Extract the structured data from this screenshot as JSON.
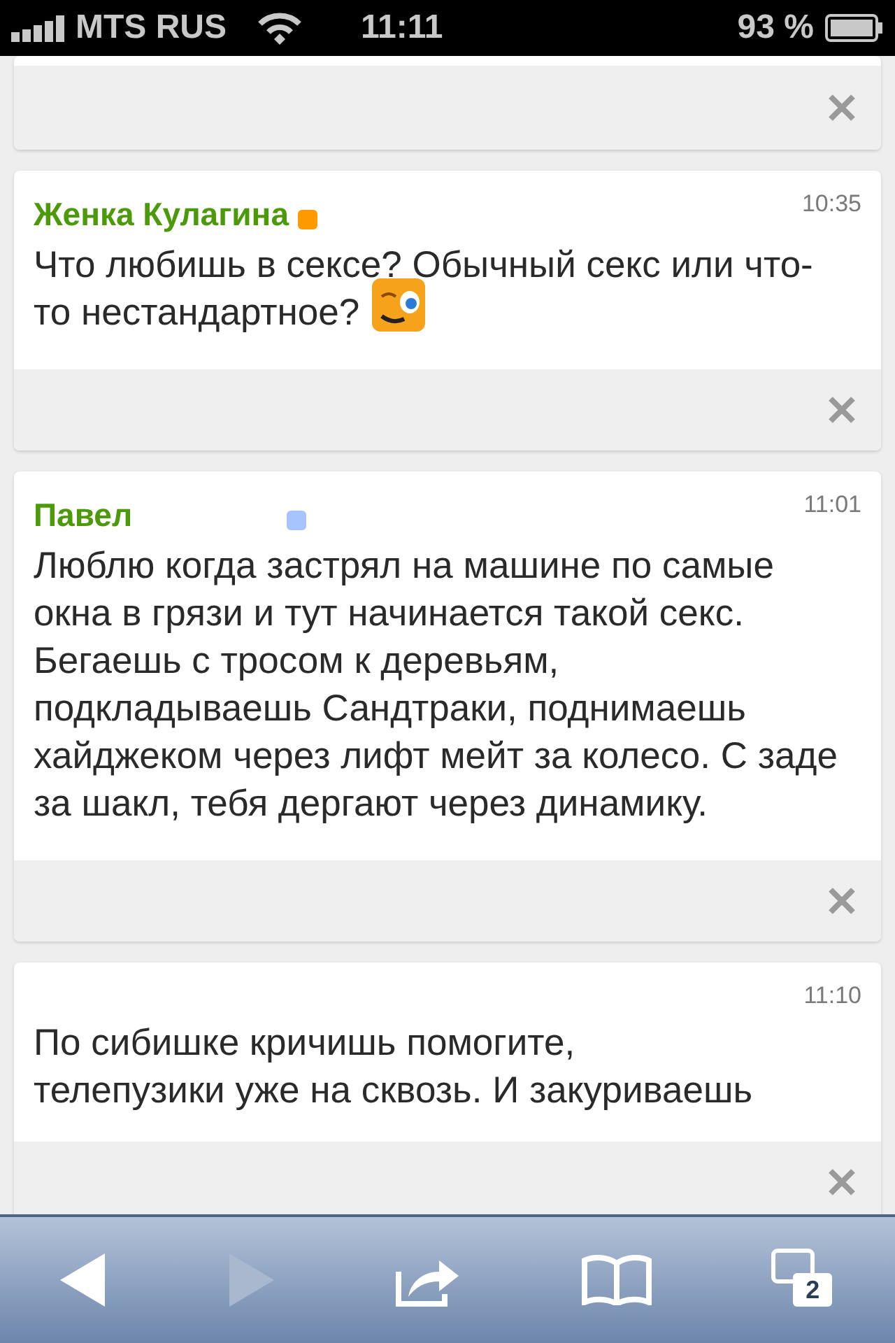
{
  "status_bar": {
    "carrier": "MTS RUS",
    "time": "11:11",
    "battery": "93 %"
  },
  "messages": [
    {
      "kind": "cut"
    },
    {
      "kind": "full",
      "author": "Женка Кулагина",
      "color": "#ff9900",
      "time": "10:35",
      "text": "Что любишь в сексе? Обычный секс или что-то нестандартное?",
      "emoji": true
    },
    {
      "kind": "full",
      "author": "Павел",
      "color": "#a8c4ff",
      "time": "11:01",
      "text": "Люблю когда застрял на машине по самые окна в грязи и тут начинается такой секс. Бегаешь с тросом к деревьям, подкладываешь Сандтраки, поднимаешь хайджеком через лифт мейт за колесо. С заде за шакл, тебя дергают через динамику."
    },
    {
      "kind": "full",
      "time": "11:10",
      "text": "По сибишке кричишь помогите, телепузики уже на сквозь. И закуриваешь"
    }
  ],
  "toolbar": {
    "tab_count": "2"
  }
}
